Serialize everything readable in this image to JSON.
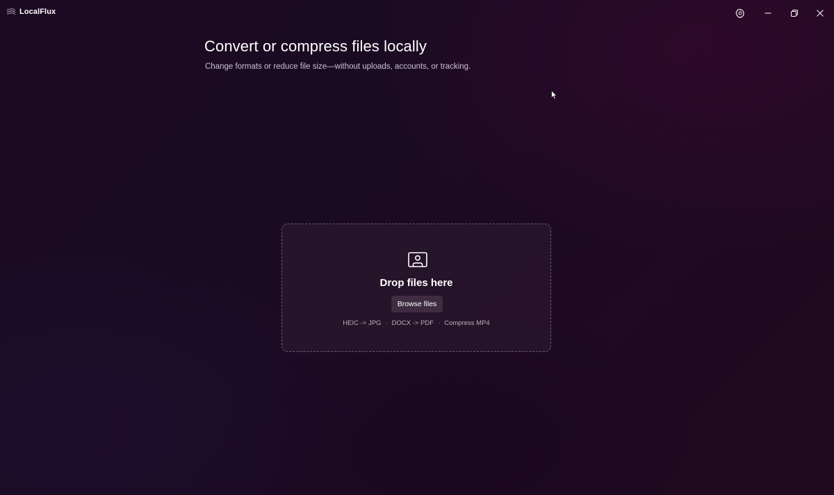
{
  "app": {
    "title": "LocalFlux",
    "icons": {
      "logo": "localflux-logo-icon",
      "settings": "gear-icon",
      "minimize": "minimize-icon",
      "restore": "restore-icon",
      "close": "close-icon"
    }
  },
  "header": {
    "title": "Convert or compress files locally",
    "subtitle": "Change formats or reduce file size—without uploads, accounts, or tracking."
  },
  "dropzone": {
    "icon": "file-upload-icon",
    "title": "Drop files here",
    "browse_label": "Browse files",
    "hints": [
      "HEIC -> JPG",
      "DOCX -> PDF",
      "Compress MP4"
    ],
    "separator": "·"
  },
  "colors": {
    "background": "#1c0a22",
    "dropzone_bg": "#2a182e",
    "text_primary": "#ffffff",
    "text_secondary": "#c9c2cd"
  }
}
